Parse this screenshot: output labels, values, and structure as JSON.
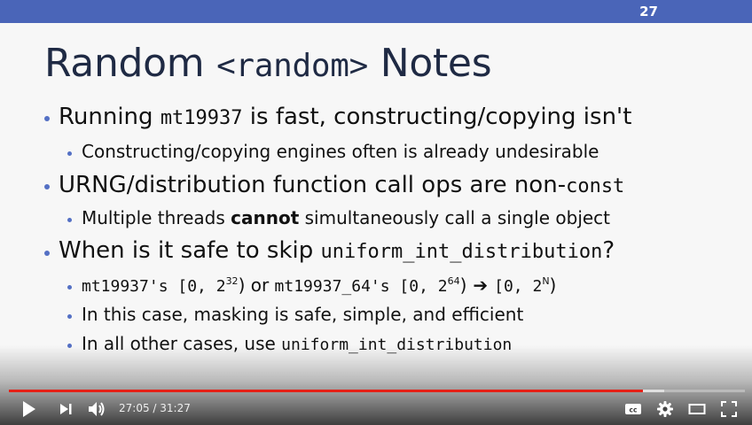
{
  "slide": {
    "number": "27",
    "title_pre": "Random ",
    "title_code": "<random>",
    "title_post": " Notes",
    "bullets": {
      "b1": {
        "pre": "Running ",
        "code": "mt19937",
        "post": " is fast, constructing/copying isn't"
      },
      "b1s1": "Constructing/copying engines often is already undesirable",
      "b2": {
        "pre": "URNG/distribution function call ops are non-",
        "code": "const"
      },
      "b2s1": {
        "pre": "Multiple threads ",
        "bold": "cannot",
        "post": " simultaneously call a single object"
      },
      "b3": {
        "pre": "When is it safe to skip ",
        "code": "uniform_int_distribution",
        "post": "?"
      },
      "b3s1": {
        "code1": "mt19937's [0, 2",
        "exp1": "32",
        "mid": ") or ",
        "code2": "mt19937_64's [0, 2",
        "exp2": "64",
        "close2": ")",
        "arrow": " ➔ ",
        "code3": "[0, 2",
        "exp3": "N",
        "close3": ")"
      },
      "b3s2": "In this case, masking is safe, simple, and efficient",
      "b3s3": {
        "pre": "In all other cases, use ",
        "code": "uniform_int_distribution"
      }
    }
  },
  "player": {
    "current_time": "27:05",
    "duration": "31:27",
    "time_text": "27:05 / 31:27",
    "progress_fraction": 0.861,
    "buffered_fraction": 0.89,
    "progress_color": "#e62117",
    "icons": [
      "play-icon",
      "next-icon",
      "volume-icon",
      "captions-icon",
      "settings-icon",
      "theater-mode-icon",
      "fullscreen-icon"
    ]
  }
}
